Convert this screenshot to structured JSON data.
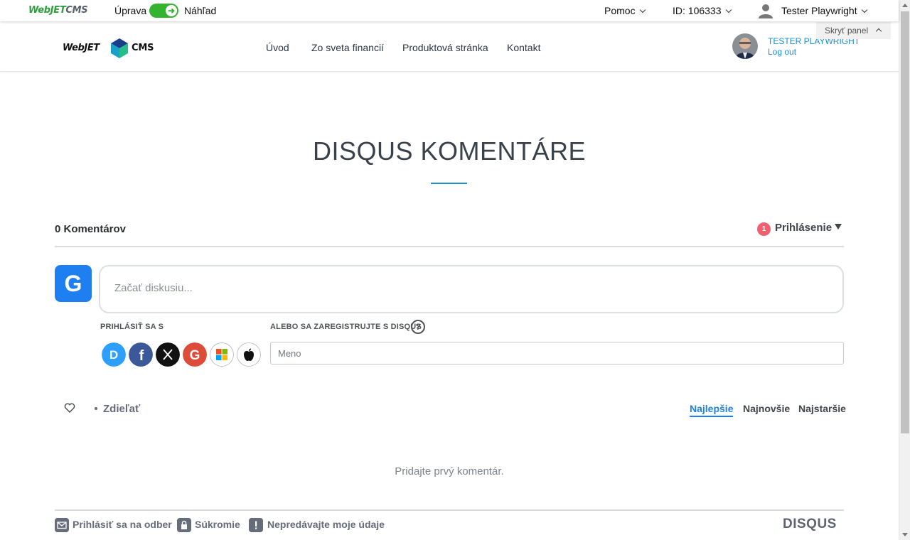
{
  "admin_bar": {
    "logo_green": "WebJET",
    "logo_gray": "CMS",
    "mode_edit": "Úprava",
    "mode_preview": "Náhľad",
    "help": "Pomoc",
    "page_id": "ID: 106333",
    "user": "Tester Playwright",
    "hide_panel": "Skryť panel"
  },
  "site": {
    "logo_text": "WebJET",
    "logo_cms": "CMS",
    "nav": [
      "Úvod",
      "Zo sveta financií",
      "Produktová stránka",
      "Kontakt"
    ],
    "user_name": "TESTER PLAYWRIGHT",
    "logout": "Log out"
  },
  "page": {
    "title": "DISQUS KOMENTÁRE"
  },
  "disqus": {
    "comment_count": "0 Komentárov",
    "notifications_count": "1",
    "login": "Prihlásenie",
    "avatar_letter": "G",
    "comment_placeholder": "Začať diskusiu...",
    "login_with": "PRIHLÁSIŤ SA S",
    "register_with": "ALEBO SA ZAREGISTRUJTE S DISQUS",
    "help_mark": "?",
    "social_providers": [
      "disqus",
      "facebook",
      "x",
      "google",
      "microsoft",
      "apple"
    ],
    "name_placeholder": "Meno",
    "share": "Zdieľať",
    "sort": [
      "Najlepšie",
      "Najnovšie",
      "Najstaršie"
    ],
    "sort_active": "Najlepšie",
    "empty_text": "Pridajte prvý komentár.",
    "footer": {
      "subscribe": "Prihlásiť sa na odber",
      "privacy": "Súkromie",
      "do_not_sell": "Nepredávajte moje údaje",
      "brand": "DISQUS"
    }
  },
  "colors": {
    "accent_blue": "#1e7ff0",
    "link_blue": "#1c8fd6",
    "toggle_green": "#33b32e",
    "badge_red": "#f05f70"
  }
}
